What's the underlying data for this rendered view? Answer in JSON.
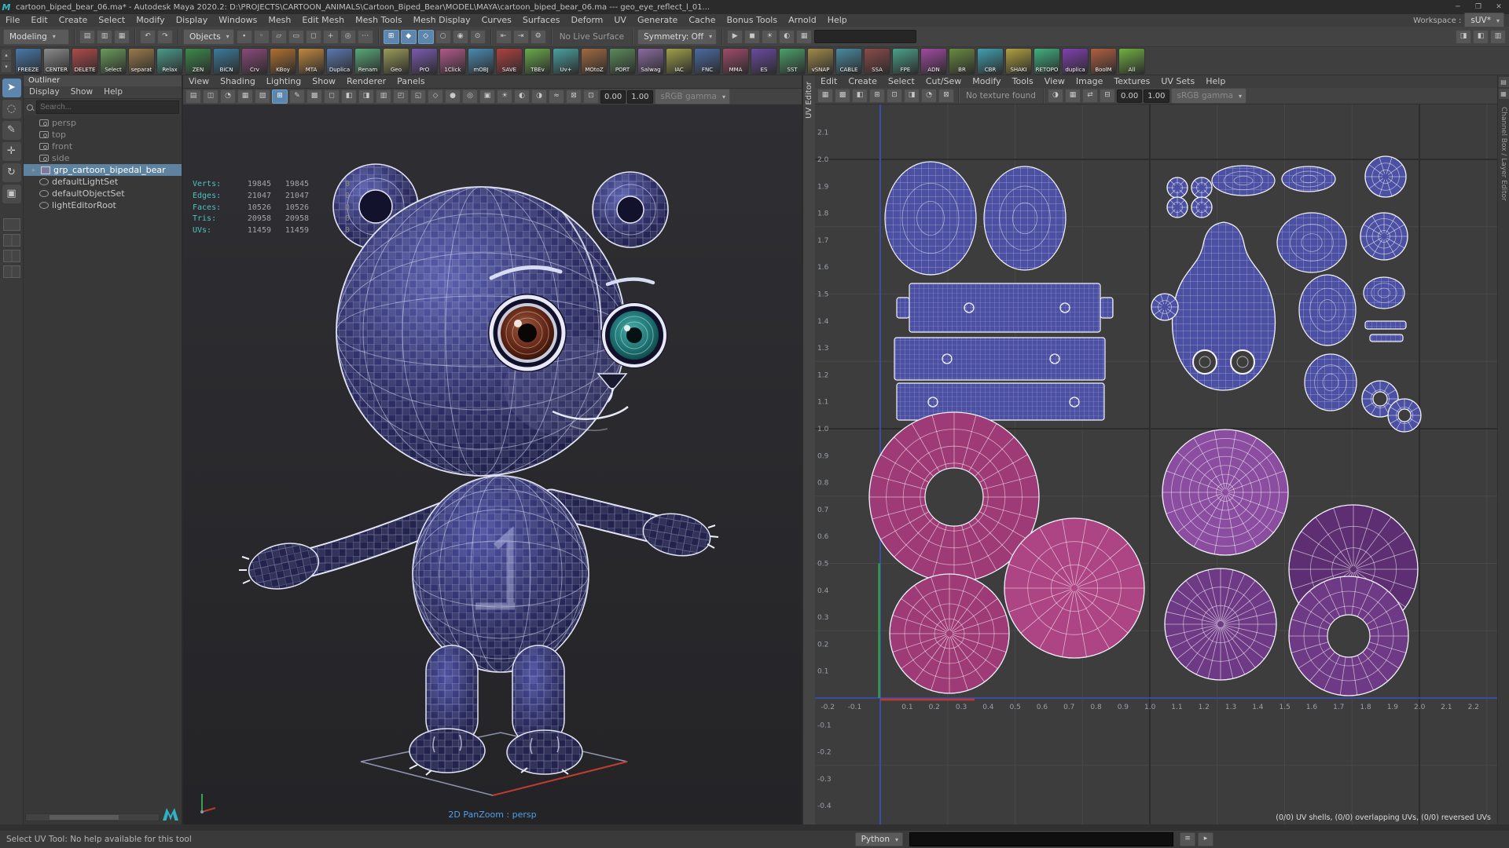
{
  "window": {
    "title": "cartoon_biped_bear_06.ma* - Autodesk Maya 2020.2: D:\\PROJECTS\\CARTOON_ANIMALS\\Cartoon_Biped_Bear\\MODEL\\MAYA\\cartoon_biped_bear_06.ma  ---  geo_eye_reflect_l_01...",
    "controls": {
      "minimize": "─",
      "maximize": "❐",
      "close": "✕"
    }
  },
  "menu_bar": {
    "items": [
      "File",
      "Edit",
      "Create",
      "Select",
      "Modify",
      "Display",
      "Windows",
      "Mesh",
      "Edit Mesh",
      "Mesh Tools",
      "Mesh Display",
      "Curves",
      "Surfaces",
      "Deform",
      "UV",
      "Generate",
      "Cache",
      "Bonus Tools",
      "Arnold",
      "Help"
    ],
    "workspace_label": "Workspace :",
    "workspace_value": "sUV*"
  },
  "status_line": {
    "mode": "Modeling",
    "objects_combo": "Objects",
    "no_live_surface": "No Live Surface",
    "symmetry": "Symmetry: Off",
    "groups": {
      "file": [
        {
          "n": "new-scene",
          "g": "▤"
        },
        {
          "n": "open-scene",
          "g": "▥"
        },
        {
          "n": "save-scene",
          "g": "▦"
        }
      ],
      "undo": [
        {
          "n": "undo",
          "g": "↶"
        },
        {
          "n": "redo",
          "g": "↷"
        }
      ],
      "mask": [
        {
          "n": "mask-points",
          "g": "∙"
        },
        {
          "n": "mask-curves",
          "g": "◦"
        },
        {
          "n": "mask-faces",
          "g": "▱"
        },
        {
          "n": "mask-hulls",
          "g": "▭"
        },
        {
          "n": "mask-objects",
          "g": "◻"
        },
        {
          "n": "mask-plus",
          "g": "+"
        },
        {
          "n": "mask-rendering",
          "g": "◎"
        },
        {
          "n": "mask-misc",
          "g": "⋯"
        }
      ],
      "snap": [
        {
          "n": "snap-grid",
          "g": "⊞",
          "active": true
        },
        {
          "n": "snap-point",
          "g": "◆",
          "active": true
        },
        {
          "n": "snap-curve",
          "g": "◇",
          "active": true
        },
        {
          "n": "snap-view-plane",
          "g": "○"
        },
        {
          "n": "make-live",
          "g": "◉"
        },
        {
          "n": "snap-center",
          "g": "⊙"
        }
      ],
      "history": [
        {
          "n": "input-operations",
          "g": "⇤"
        },
        {
          "n": "output-operations",
          "g": "⇥"
        },
        {
          "n": "construction-history",
          "g": "⚙"
        }
      ],
      "render": [
        {
          "n": "render-current-frame",
          "g": "▶"
        },
        {
          "n": "ipr-render",
          "g": "◼"
        },
        {
          "n": "render-settings",
          "g": "☀"
        },
        {
          "n": "light-editor",
          "g": "◐"
        },
        {
          "n": "paint-effects",
          "g": "▦"
        }
      ],
      "sidebar": [
        {
          "n": "toggle-attribute-editor",
          "g": "◨"
        },
        {
          "n": "toggle-tool-settings",
          "g": "◧"
        },
        {
          "n": "toggle-channel-box",
          "g": "▥"
        }
      ]
    }
  },
  "shelf": {
    "items": [
      {
        "label": "FREEZE",
        "color": "#4878a8"
      },
      {
        "label": "CENTER",
        "color": "#8a8a8a"
      },
      {
        "label": "DELETE",
        "color": "#b04a4a"
      },
      {
        "label": "Select",
        "color": "#6a9a5a"
      },
      {
        "label": "separat",
        "color": "#9a7a4a"
      },
      {
        "label": "Relax",
        "color": "#4a9a8a"
      },
      {
        "label": "ZEN",
        "color": "#3a8a4a"
      },
      {
        "label": "BiCN",
        "color": "#3a7a9a"
      },
      {
        "label": "Crv",
        "color": "#8a4a7a"
      },
      {
        "label": "KBoy",
        "color": "#b07030"
      },
      {
        "label": "MTA",
        "color": "#c08840"
      },
      {
        "label": "Duplica",
        "color": "#5a78b0"
      },
      {
        "label": "Renam",
        "color": "#58a878"
      },
      {
        "label": "Geo",
        "color": "#9a9a5a"
      },
      {
        "label": "PrO",
        "color": "#7a5ab0"
      },
      {
        "label": "1Click",
        "color": "#b05a8a"
      },
      {
        "label": "mOBJ",
        "color": "#4a8ab0"
      },
      {
        "label": "SAVE",
        "color": "#b04040"
      },
      {
        "label": "TBEv",
        "color": "#6aaa4a"
      },
      {
        "label": "Uv+",
        "color": "#4aa0a0"
      },
      {
        "label": "MOtoZ",
        "color": "#a06a40"
      },
      {
        "label": "PORT",
        "color": "#5a8a5a"
      },
      {
        "label": "Salwag",
        "color": "#8a6aa0"
      },
      {
        "label": "IAC",
        "color": "#a0a04a"
      },
      {
        "label": "FNC",
        "color": "#4a6aa0"
      },
      {
        "label": "MMA",
        "color": "#a04a6a"
      },
      {
        "label": "ES",
        "color": "#6a4aa0"
      },
      {
        "label": "SST",
        "color": "#4aa06a"
      },
      {
        "label": "vSNAP",
        "color": "#a08a4a"
      },
      {
        "label": "CABLE",
        "color": "#4a8aa0"
      },
      {
        "label": "SSA",
        "color": "#8a4a4a"
      },
      {
        "label": "FPE",
        "color": "#4aa08a"
      },
      {
        "label": "ADN",
        "color": "#a04aa0"
      },
      {
        "label": "BR",
        "color": "#6a8a40"
      },
      {
        "label": "CBR",
        "color": "#40a0b0"
      },
      {
        "label": "SHAKI",
        "color": "#b0a040"
      },
      {
        "label": "RETOPO",
        "color": "#40b080"
      },
      {
        "label": "duplica",
        "color": "#8040b0"
      },
      {
        "label": "BoolM",
        "color": "#b06040"
      },
      {
        "label": "All",
        "color": "#70b040"
      }
    ]
  },
  "toolbox": {
    "tools": [
      {
        "n": "select-tool",
        "g": "➤",
        "active": true
      },
      {
        "n": "lasso-select-tool",
        "g": "◌"
      },
      {
        "n": "paint-select-tool",
        "g": "✎"
      },
      {
        "n": "move-tool",
        "g": "✛"
      },
      {
        "n": "rotate-tool",
        "g": "↻"
      },
      {
        "n": "scale-tool",
        "g": "▣"
      }
    ]
  },
  "outliner": {
    "title": "Outliner",
    "menus": [
      "Display",
      "Show",
      "Help"
    ],
    "search_placeholder": "Search...",
    "items": [
      {
        "label": "persp",
        "icon": "cam",
        "dim": true
      },
      {
        "label": "top",
        "icon": "cam",
        "dim": true
      },
      {
        "label": "front",
        "icon": "cam",
        "dim": true
      },
      {
        "label": "side",
        "icon": "cam",
        "dim": true
      },
      {
        "label": "grp_cartoon_bipedal_bear",
        "icon": "grp",
        "selected": true,
        "expand": "▸"
      },
      {
        "label": "defaultLightSet",
        "icon": "set"
      },
      {
        "label": "defaultObjectSet",
        "icon": "set"
      },
      {
        "label": "lightEditorRoot",
        "icon": "set"
      }
    ]
  },
  "viewport": {
    "menus": [
      "View",
      "Shading",
      "Lighting",
      "Show",
      "Renderer",
      "Panels"
    ],
    "toolbar": {
      "exposure": "0.00",
      "gamma_value": "1.00",
      "gamma_label": "sRGB gamma",
      "icons": [
        {
          "n": "select-camera",
          "g": "▤"
        },
        {
          "n": "lock-camera",
          "g": "◫"
        },
        {
          "n": "camera-attributes",
          "g": "◔"
        },
        {
          "n": "bookmarks",
          "g": "▦"
        },
        {
          "n": "image-plane",
          "g": "▧"
        },
        {
          "n": "two-d-pan-zoom",
          "g": "⊞",
          "active": true
        },
        {
          "n": "grease-pencil",
          "g": "✎"
        },
        {
          "n": "grid-toggle",
          "g": "▩"
        },
        {
          "n": "film-gate",
          "g": "◻"
        },
        {
          "n": "resolution-gate",
          "g": "◧"
        },
        {
          "n": "gate-mask",
          "g": "◨"
        },
        {
          "n": "field-chart",
          "g": "▥"
        },
        {
          "n": "safe-action",
          "g": "◰"
        },
        {
          "n": "safe-title",
          "g": "◱"
        },
        {
          "n": "wireframe",
          "g": "◇"
        },
        {
          "n": "smooth-shade",
          "g": "●"
        },
        {
          "n": "wireframe-on-shaded",
          "g": "◎"
        },
        {
          "n": "textured",
          "g": "▣"
        },
        {
          "n": "use-all-lights",
          "g": "☀"
        },
        {
          "n": "shadows",
          "g": "◐"
        },
        {
          "n": "ambient-occlusion",
          "g": "◑"
        },
        {
          "n": "motion-blur",
          "g": "≈"
        },
        {
          "n": "xray",
          "g": "⊠"
        },
        {
          "n": "isolate-select",
          "g": "⊡"
        }
      ]
    },
    "hud": {
      "rows": [
        {
          "label": "Verts:",
          "v1": "19845",
          "v2": "19845",
          "v3": "0"
        },
        {
          "label": "Edges:",
          "v1": "21047",
          "v2": "21047",
          "v3": "0"
        },
        {
          "label": "Faces:",
          "v1": "10526",
          "v2": "10526",
          "v3": "0"
        },
        {
          "label": "Tris:",
          "v1": "20958",
          "v2": "20958",
          "v3": "0"
        },
        {
          "label": "UVs:",
          "v1": "11459",
          "v2": "11459",
          "v3": "0"
        }
      ]
    },
    "overlay": "2D PanZoom : persp"
  },
  "uv_editor": {
    "tab_label": "UV Editor",
    "menus": [
      "Edit",
      "Create",
      "Select",
      "Cut/Sew",
      "Modify",
      "Tools",
      "View",
      "Image",
      "Textures",
      "UV Sets",
      "Help"
    ],
    "toolbar": {
      "no_texture": "No texture found",
      "exposure": "0.00",
      "gamma_value": "1.00",
      "gamma_label": "sRGB gamma",
      "icons_left": [
        {
          "n": "uv-distortion",
          "g": "▦"
        },
        {
          "n": "checker-map",
          "g": "▩"
        },
        {
          "n": "texture-borders",
          "g": "◧"
        },
        {
          "n": "uv-grid",
          "g": "⊞"
        },
        {
          "n": "pixel-snap",
          "g": "⊡"
        },
        {
          "n": "shaded-uvs",
          "g": "◨"
        },
        {
          "n": "uv-statistics",
          "g": "◔"
        },
        {
          "n": "isolate-select-uv",
          "g": "⊠"
        }
      ],
      "icons_right": [
        {
          "n": "dim-image",
          "g": "◑"
        },
        {
          "n": "view-transform",
          "g": "▦"
        },
        {
          "n": "pan-zoom-uv",
          "g": "⇄"
        },
        {
          "n": "frame-all-uv",
          "g": "⊟"
        }
      ]
    },
    "axis": {
      "left_ticks": [
        "2.1",
        "2.0",
        "1.9",
        "1.8",
        "1.7",
        "1.6",
        "1.5",
        "1.4",
        "1.3",
        "1.2",
        "1.1",
        "1.0",
        "0.9",
        "0.8",
        "0.7",
        "0.6",
        "0.5",
        "0.4",
        "0.3",
        "0.2",
        "0.1",
        "-0.1",
        "-0.2",
        "-0.3",
        "-0.4"
      ],
      "bottom_ticks": [
        "-0.2",
        "-0.1",
        "0.1",
        "0.2",
        "0.3",
        "0.4",
        "0.5",
        "0.6",
        "0.7",
        "0.8",
        "0.9",
        "1.0",
        "1.1",
        "1.2",
        "1.3",
        "1.4",
        "1.5",
        "1.6",
        "1.7",
        "1.8",
        "1.9",
        "2.0",
        "2.1",
        "2.2"
      ]
    },
    "status": "(0/0) UV shells, (0/0) overlapping UVs, (0/0) reversed UVs"
  },
  "right_strip": {
    "icons": [
      {
        "n": "channel-box-toggle",
        "g": "▤"
      },
      {
        "n": "layer-editor-toggle",
        "g": "▦"
      }
    ],
    "label": "Channel Box / Layer Editor"
  },
  "bottom_bar": {
    "help": "Select UV Tool: No help available for this tool",
    "script_label": "Python",
    "icons": [
      {
        "n": "script-editor",
        "g": "≡"
      },
      {
        "n": "command-shell",
        "g": "▸"
      }
    ]
  },
  "colors": {
    "selection": "#5d83a1",
    "hud_label": "#4fc0c0",
    "panzoom_label": "#4f9fe8",
    "axis_u_red": "#c0392b",
    "axis_v_green": "#2e9e3e",
    "axis_zero_blue": "#3c55c8",
    "shell_blue": "#4b50a3",
    "shell_magenta": "#9e3a76",
    "shell_magenta_bright": "#ad4483",
    "shell_purple": "#6f3a85",
    "shell_purple_dark": "#5d2f72",
    "shell_purple_light": "#8a4da0",
    "uv_bg": "#3d3d3d"
  }
}
